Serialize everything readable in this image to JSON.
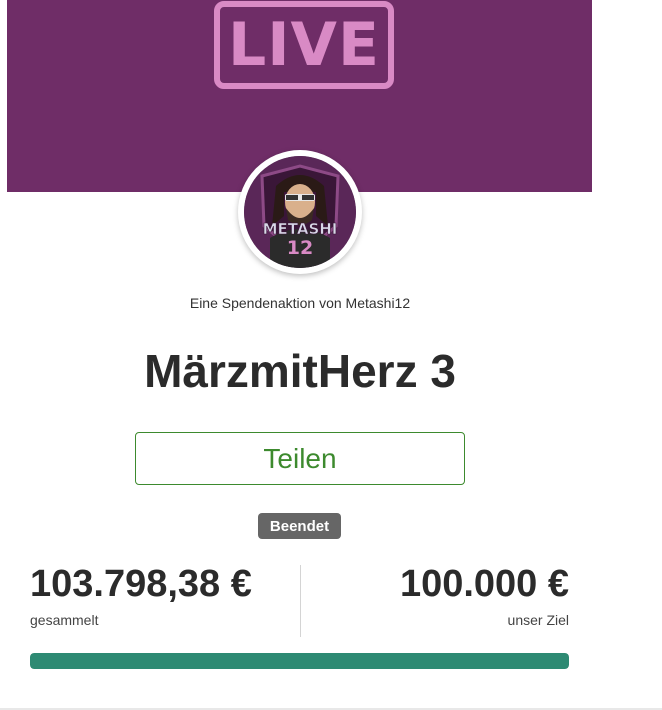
{
  "banner": {
    "live_label": "LIVE",
    "background": "#6f2d67",
    "accent": "#d98ac5"
  },
  "avatar": {
    "text_top": "METASHI",
    "text_bottom": "12",
    "icon": "streamer-avatar"
  },
  "campaign": {
    "subtitle": "Eine Spendenaktion von Metashi12",
    "title": "MärzmitHerz 3",
    "share_label": "Teilen",
    "status_badge": "Beendet"
  },
  "stats": {
    "raised_amount": "103.798,38 €",
    "raised_label": "gesammelt",
    "goal_amount": "100.000 €",
    "goal_label": "unser Ziel",
    "progress_percent": 100
  },
  "colors": {
    "share_green": "#3d8a2e",
    "progress_fill": "#2e8a73",
    "badge_gray": "#666666"
  }
}
